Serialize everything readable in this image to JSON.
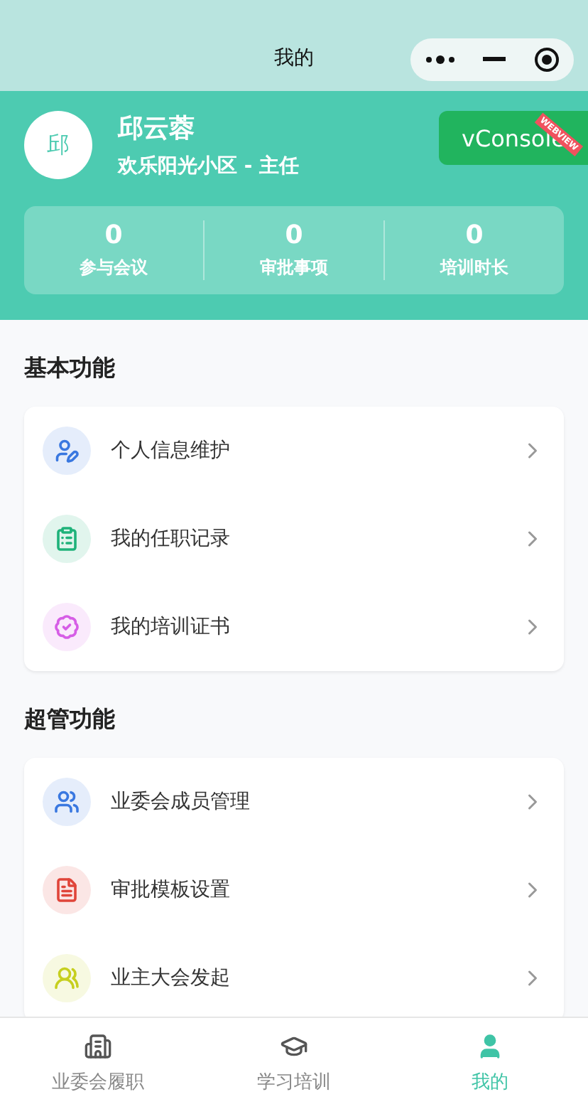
{
  "nav_bar": {
    "title": "我的"
  },
  "profile": {
    "avatar": "邱",
    "name": "邱云蓉",
    "subtitle": "欢乐阳光小区 - 主任"
  },
  "vconsole": {
    "label": "vConsole",
    "ribbon": "WEBVIEW"
  },
  "stats": [
    {
      "value": "0",
      "label": "参与会议"
    },
    {
      "value": "0",
      "label": "审批事项"
    },
    {
      "value": "0",
      "label": "培训时长"
    }
  ],
  "sections": [
    {
      "title": "基本功能",
      "items": [
        {
          "label": "个人信息维护",
          "color": "#3a78e0"
        },
        {
          "label": "我的任职记录",
          "color": "#1fb27a"
        },
        {
          "label": "我的培训证书",
          "color": "#d65ee6"
        }
      ]
    },
    {
      "title": "超管功能",
      "items": [
        {
          "label": "业委会成员管理",
          "color": "#3a78e0"
        },
        {
          "label": "审批模板设置",
          "color": "#e0453a"
        },
        {
          "label": "业主大会发起",
          "color": "#c6cf1f"
        }
      ]
    }
  ],
  "tab_bar": [
    {
      "label": "业委会履职",
      "selected": false
    },
    {
      "label": "学习培训",
      "selected": false
    },
    {
      "label": "我的",
      "selected": true
    }
  ]
}
